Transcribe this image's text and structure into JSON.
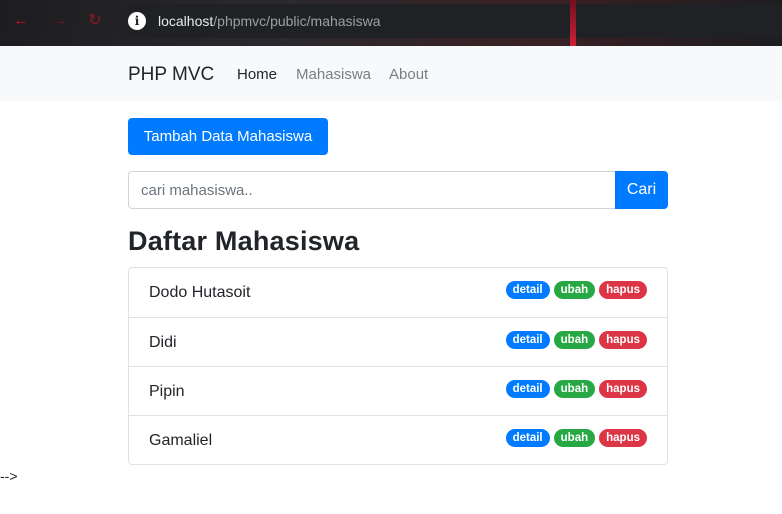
{
  "browser": {
    "url_host": "localhost",
    "url_path": "/phpmvc/public/mahasiswa",
    "icons": {
      "back": "back-arrow-icon",
      "forward": "forward-arrow-icon",
      "reload": "reload-icon",
      "site_info": "info-icon"
    }
  },
  "navbar": {
    "brand": "PHP MVC",
    "links": [
      {
        "label": "Home",
        "active": true
      },
      {
        "label": "Mahasiswa",
        "active": false
      },
      {
        "label": "About",
        "active": false
      }
    ]
  },
  "main": {
    "add_button": "Tambah Data Mahasiswa",
    "search": {
      "placeholder": "cari mahasiswa..",
      "value": "",
      "button": "Cari"
    },
    "title": "Daftar Mahasiswa",
    "students": [
      {
        "name": "Dodo Hutasoit",
        "actions": [
          "detail",
          "ubah",
          "hapus"
        ]
      },
      {
        "name": "Didi",
        "actions": [
          "detail",
          "ubah",
          "hapus"
        ]
      },
      {
        "name": "Pipin",
        "actions": [
          "detail",
          "ubah",
          "hapus"
        ]
      },
      {
        "name": "Gamaliel",
        "actions": [
          "detail",
          "ubah",
          "hapus"
        ]
      }
    ]
  },
  "stray_text": "-->",
  "colors": {
    "primary": "#007bff",
    "success": "#28a745",
    "danger": "#dc3545",
    "navbar_bg": "#f8f9fa"
  }
}
